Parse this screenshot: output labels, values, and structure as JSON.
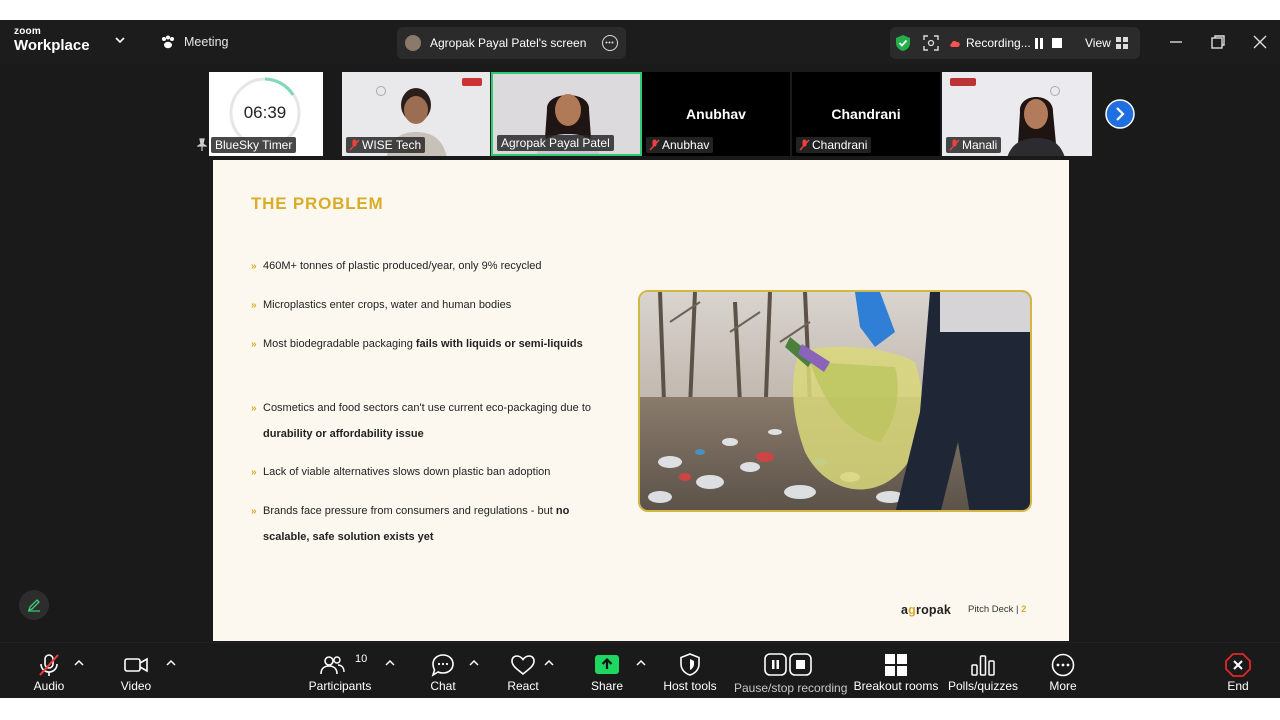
{
  "app": {
    "logo_line1": "zoom",
    "logo_line2": "Workplace",
    "meeting_tab": "Meeting",
    "share_title": "Agropak Payal Patel's screen",
    "recording": "Recording...",
    "view": "View"
  },
  "participants_strip": [
    {
      "name": "BlueSky Timer",
      "timer": "06:39"
    },
    {
      "name": "WISE Tech"
    },
    {
      "name": "Agropak Payal Patel"
    },
    {
      "name": "Anubhav",
      "display": "Anubhav"
    },
    {
      "name": "Chandrani",
      "display": "Chandrani"
    },
    {
      "name": "Manali"
    }
  ],
  "slide": {
    "title": "THE PROBLEM",
    "bullets": [
      {
        "text": "460M+ tonnes of plastic produced/year, only 9% recycled"
      },
      {
        "text": "Microplastics enter crops, water and human bodies"
      },
      {
        "pre": "Most biodegradable packaging ",
        "bold": "fails with liquids or semi-liquids",
        "post": ""
      },
      {
        "pre": "Cosmetics and food sectors can't use current eco-packaging due to ",
        "bold": "durability or affordability issue",
        "post": ""
      },
      {
        "text": "Lack of viable alternatives slows down plastic ban adoption"
      },
      {
        "pre": "Brands face pressure from consumers and regulations - but ",
        "bold": "no scalable, safe solution exists yet",
        "post": ""
      }
    ],
    "brand_pre": "a",
    "brand_o": "g",
    "brand_post": "ropak",
    "footer": "Pitch Deck | ",
    "page": "2"
  },
  "toolbar": {
    "audio": "Audio",
    "video": "Video",
    "participants": "Participants",
    "participants_count": "10",
    "chat": "Chat",
    "react": "React",
    "share": "Share",
    "host_tools": "Host tools",
    "pause_stop": "Pause/stop recording",
    "breakout": "Breakout rooms",
    "polls": "Polls/quizzes",
    "more": "More",
    "end": "End"
  },
  "colors": {
    "accent_gold": "#d9ac2a",
    "share_green": "#1ed760",
    "end_red": "#e02828",
    "active_speaker": "#2ecc71"
  }
}
